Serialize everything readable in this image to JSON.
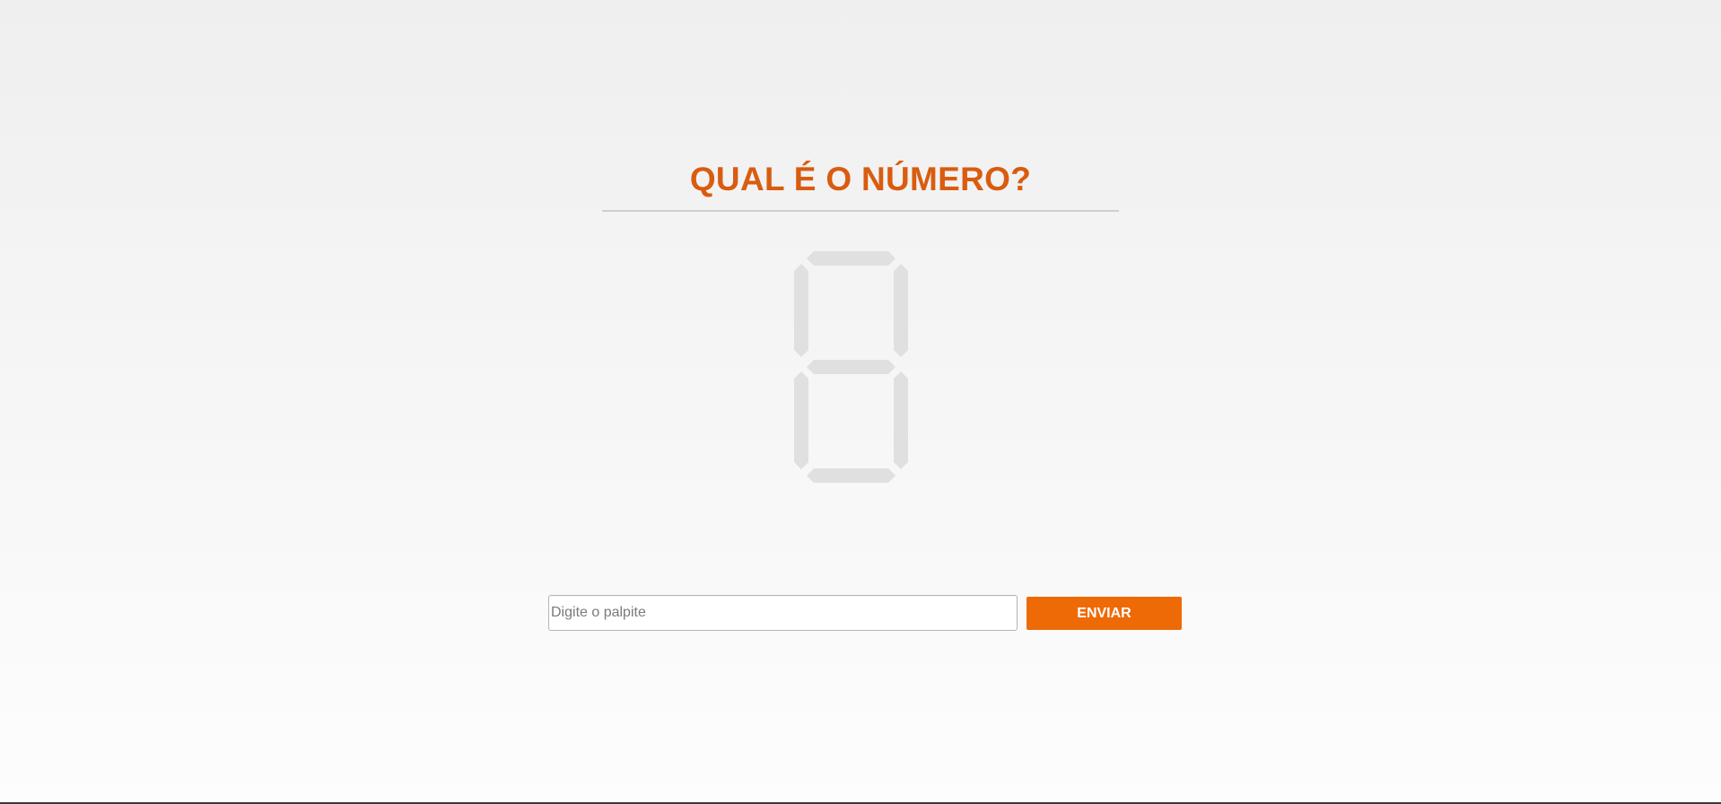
{
  "header": {
    "title": "QUAL É O NÚMERO?"
  },
  "display": {
    "value": "",
    "segment_color_off": "#e0e0e0",
    "segments_lit": []
  },
  "form": {
    "guess_placeholder": "Digite o palpite",
    "guess_value": "",
    "submit_label": "ENVIAR"
  },
  "colors": {
    "accent": "#ee6a07",
    "title": "#d95c10"
  }
}
